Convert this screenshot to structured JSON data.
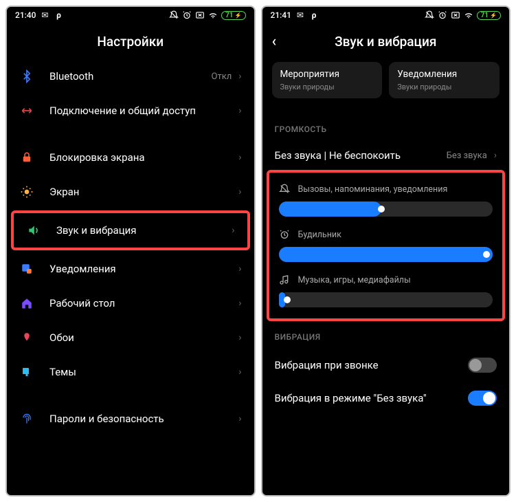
{
  "left": {
    "status": {
      "time": "21:40",
      "battery": "71"
    },
    "title": "Настройки",
    "rows": {
      "bluetooth": {
        "label": "Bluetooth",
        "value": "Откл"
      },
      "sharing": {
        "label": "Подключение и общий доступ"
      },
      "lockscreen": {
        "label": "Блокировка экрана"
      },
      "display": {
        "label": "Экран"
      },
      "sound": {
        "label": "Звук и вибрация"
      },
      "notifications": {
        "label": "Уведомления"
      },
      "home": {
        "label": "Рабочий стол"
      },
      "wallpaper": {
        "label": "Обои"
      },
      "themes": {
        "label": "Темы"
      },
      "security": {
        "label": "Пароли и безопасность"
      }
    }
  },
  "right": {
    "status": {
      "time": "21:41",
      "battery": "71"
    },
    "title": "Звук и вибрация",
    "cards": {
      "events": {
        "title": "Мероприятия",
        "sub": "Звуки природы"
      },
      "notif": {
        "title": "Уведомления",
        "sub": "Звуки природы"
      }
    },
    "sections": {
      "volume": "ГРОМКОСТЬ",
      "vibration": "ВИБРАЦИЯ"
    },
    "silent": {
      "label": "Без звука | Не беспокоить",
      "value": "Без звука"
    },
    "sliders": {
      "calls": {
        "label": "Вызовы, напоминания, уведомления",
        "percent": 48
      },
      "alarm": {
        "label": "Будильник",
        "percent": 100
      },
      "media": {
        "label": "Музыка, игры, медиафайлы",
        "percent": 3
      }
    },
    "toggles": {
      "vibcall": {
        "label": "Вибрация при звонке",
        "on": false
      },
      "vibsilent": {
        "label": "Вибрация в режиме \"Без звука\"",
        "on": true
      }
    }
  }
}
